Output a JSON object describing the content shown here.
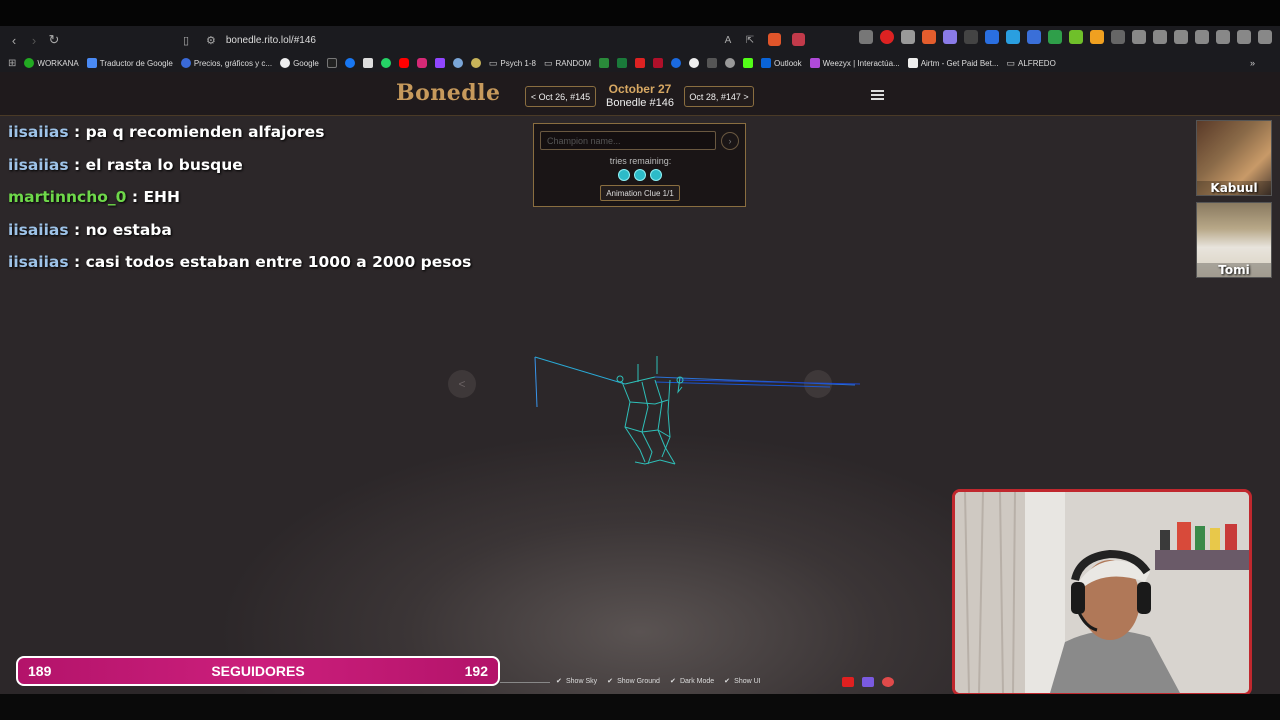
{
  "browser": {
    "url": "bonedle.rito.lol/#146",
    "bookmarks": [
      "WORKANA",
      "Traductor de Google",
      "Precios, gráficos y c...",
      "Google",
      "Psych 1-8",
      "RANDOM",
      "Outlook",
      "Weezyx | Interactúa...",
      "Airtm - Get Paid Bet...",
      "ALFREDO"
    ]
  },
  "site": {
    "logo": "Bonedle",
    "prev": "< Oct 26, #145",
    "date": "October 27",
    "puzzle": "Bonedle #146",
    "next": "Oct 28, #147 >",
    "input_placeholder": "Champion name...",
    "go": "›",
    "tries_label": "tries remaining:",
    "tries_remaining": 3,
    "clue_button": "Animation Clue 1/1",
    "prev_arrow": "<"
  },
  "chat": [
    {
      "user": "iisaiias",
      "color": "#9ec3e8",
      "message": " : pa q recomienden alfajores"
    },
    {
      "user": "iisaiias",
      "color": "#9ec3e8",
      "message": " : el rasta lo busque"
    },
    {
      "user": "martinncho_0",
      "color": "#6ed84a",
      "message": " : EHH"
    },
    {
      "user": "iisaiias",
      "color": "#9ec3e8",
      "message": " : no estaba"
    },
    {
      "user": "iisaiias",
      "color": "#9ec3e8",
      "message": " : casi todos estaban entre 1000 a 2000 pesos"
    }
  ],
  "cams": [
    {
      "name": "Kabuul"
    },
    {
      "name": "Tomi"
    }
  ],
  "followers": {
    "current": "189",
    "label": "SEGUIDORES",
    "goal": "192"
  },
  "toggles": [
    "Show Sky",
    "Show Ground",
    "Dark Mode",
    "Show UI"
  ],
  "colors": {
    "accent": "#c79a5c",
    "tries_dot": "#2dbbc8",
    "followers_bar": "#cc1f7c",
    "webcam_border": "#c0282e"
  }
}
